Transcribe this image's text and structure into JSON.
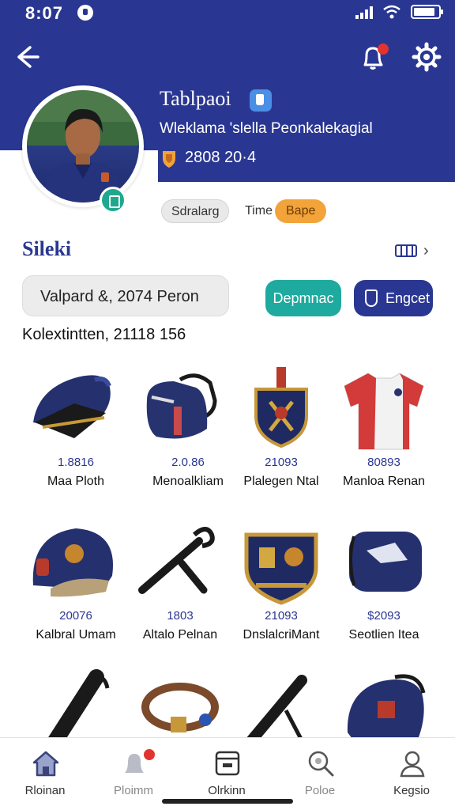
{
  "status": {
    "time": "8:07"
  },
  "profile": {
    "name": "Tablpaoi",
    "subtitle": "Wleklama 'slella Peonkalekagial",
    "stats": "2808 20·4",
    "chips": [
      "Sdralarg",
      "Time",
      "Bape"
    ]
  },
  "section": {
    "title": "Sileki"
  },
  "search": {
    "value": "Valpard &, 2074 Peron"
  },
  "buttons": {
    "teal": "Depmnac",
    "navy": "Engcet"
  },
  "collection": {
    "label": "Kolextintten, 21118 156"
  },
  "items": [
    {
      "price": "1.8816",
      "name": "Maa Ploth",
      "icon": "cap-icon"
    },
    {
      "price": "2.0.86",
      "name": "Menoalkliam",
      "icon": "backpack-icon"
    },
    {
      "price": "21093",
      "name": "Plalegen Ntal",
      "icon": "crest-icon"
    },
    {
      "price": "80893",
      "name": "Manloa Renan",
      "icon": "jersey-icon"
    },
    {
      "price": "20076",
      "name": "Kalbral Umam",
      "icon": "helmet-icon"
    },
    {
      "price": "1803",
      "name": "Altalo Pelnan",
      "icon": "hammer-icon"
    },
    {
      "price": "21093",
      "name": "DnslalcriMant",
      "icon": "shield-badge-icon"
    },
    {
      "price": "$2093",
      "name": "Seotlien Itea",
      "icon": "bag-icon"
    },
    {
      "price": "",
      "name": "",
      "icon": "bat-icon"
    },
    {
      "price": "",
      "name": "",
      "icon": "belt-icon"
    },
    {
      "price": "",
      "name": "",
      "icon": "stick-icon"
    },
    {
      "price": "",
      "name": "",
      "icon": "pack-icon"
    }
  ],
  "nav": [
    {
      "label": "Rloinan",
      "icon": "home-icon"
    },
    {
      "label": "Ploimm",
      "icon": "bell-icon"
    },
    {
      "label": "Olrkinn",
      "icon": "box-icon"
    },
    {
      "label": "Poloe",
      "icon": "search-icon"
    },
    {
      "label": "Kegsio",
      "icon": "profile-icon"
    }
  ],
  "colors": {
    "primary": "#2a3792",
    "teal": "#1eaa9e",
    "orange": "#f2a43a",
    "badge": "#e2342f"
  }
}
